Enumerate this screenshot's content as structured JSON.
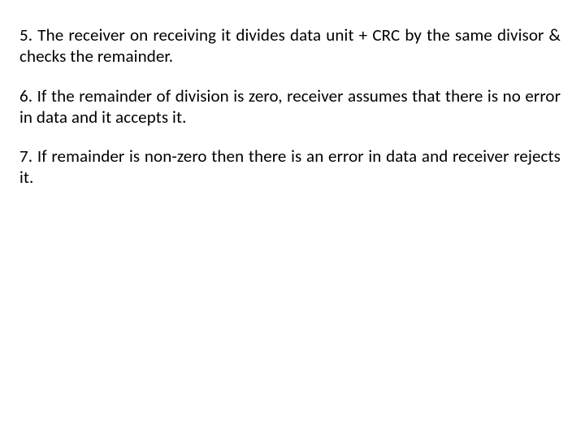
{
  "paragraphs": {
    "p5": "5. The receiver on receiving it divides data unit + CRC by the same divisor & checks the remainder.",
    "p6": "6. If the remainder of division is zero, receiver assumes that there is no error in data and it accepts it.",
    "p7": "7. If remainder is non-zero then there is an error in data and receiver rejects it."
  }
}
